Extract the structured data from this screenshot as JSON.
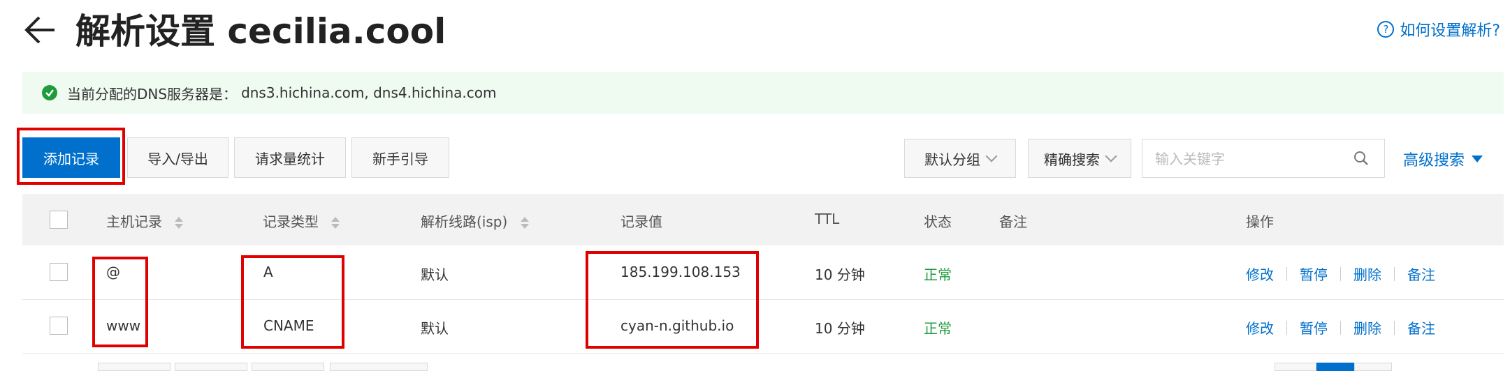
{
  "header": {
    "title": "解析设置 cecilia.cool",
    "help_link": "如何设置解析?"
  },
  "dns_notice": {
    "label": "当前分配的DNS服务器是：",
    "servers": "dns3.hichina.com, dns4.hichina.com"
  },
  "toolbar": {
    "add_record": "添加记录",
    "import_export": "导入/导出",
    "request_stats": "请求量统计",
    "guide": "新手引导",
    "group_select": "默认分组",
    "search_mode": "精确搜索",
    "search_placeholder": "输入关键字",
    "advanced_search": "高级搜索"
  },
  "table": {
    "headers": {
      "host": "主机记录",
      "type": "记录类型",
      "line": "解析线路(isp)",
      "value": "记录值",
      "ttl": "TTL",
      "status": "状态",
      "remark": "备注",
      "actions": "操作"
    },
    "rows": [
      {
        "host": "@",
        "type": "A",
        "line": "默认",
        "value": "185.199.108.153",
        "ttl": "10 分钟",
        "status": "正常"
      },
      {
        "host": "www",
        "type": "CNAME",
        "line": "默认",
        "value": "cyan-n.github.io",
        "ttl": "10 分钟",
        "status": "正常"
      }
    ],
    "actions": {
      "edit": "修改",
      "pause": "暂停",
      "delete": "删除",
      "remark": "备注"
    }
  },
  "colors": {
    "accent": "#0070cc",
    "success": "#1e9b3b",
    "highlight": "#e00000",
    "notice_bg": "#effaf1"
  }
}
